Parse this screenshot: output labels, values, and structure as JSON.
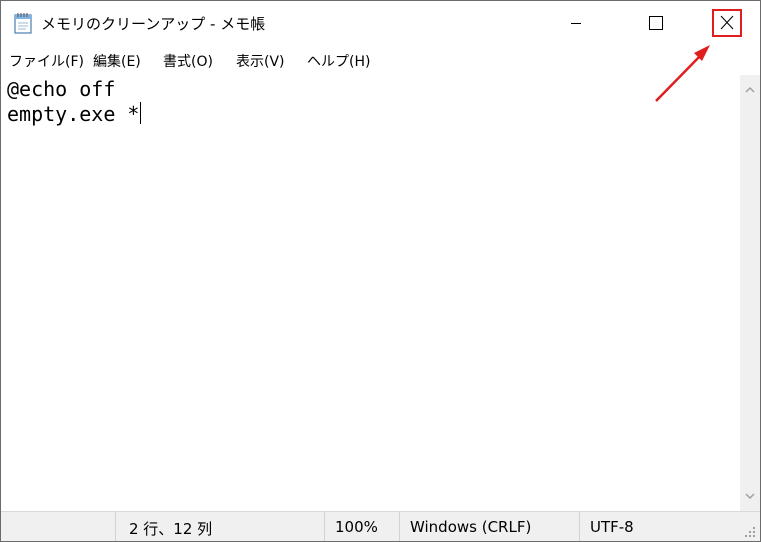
{
  "window": {
    "title": "メモリのクリーンアップ - メモ帳"
  },
  "menu": {
    "items": [
      {
        "label": "ファイル(F)"
      },
      {
        "label": "編集(E)"
      },
      {
        "label": "書式(O)"
      },
      {
        "label": "表示(V)"
      },
      {
        "label": "ヘルプ(H)"
      }
    ]
  },
  "editor": {
    "lines": [
      "@echo off",
      "empty.exe *"
    ]
  },
  "status": {
    "position": "2 行、12 列",
    "zoom": "100%",
    "line_ending": "Windows (CRLF)",
    "encoding": "UTF-8"
  },
  "colors": {
    "highlight": "#e01e1e"
  },
  "icons": [
    "notepad-icon",
    "minimize-icon",
    "maximize-icon",
    "close-icon",
    "scroll-up-icon",
    "scroll-down-icon",
    "resize-grip-icon"
  ]
}
